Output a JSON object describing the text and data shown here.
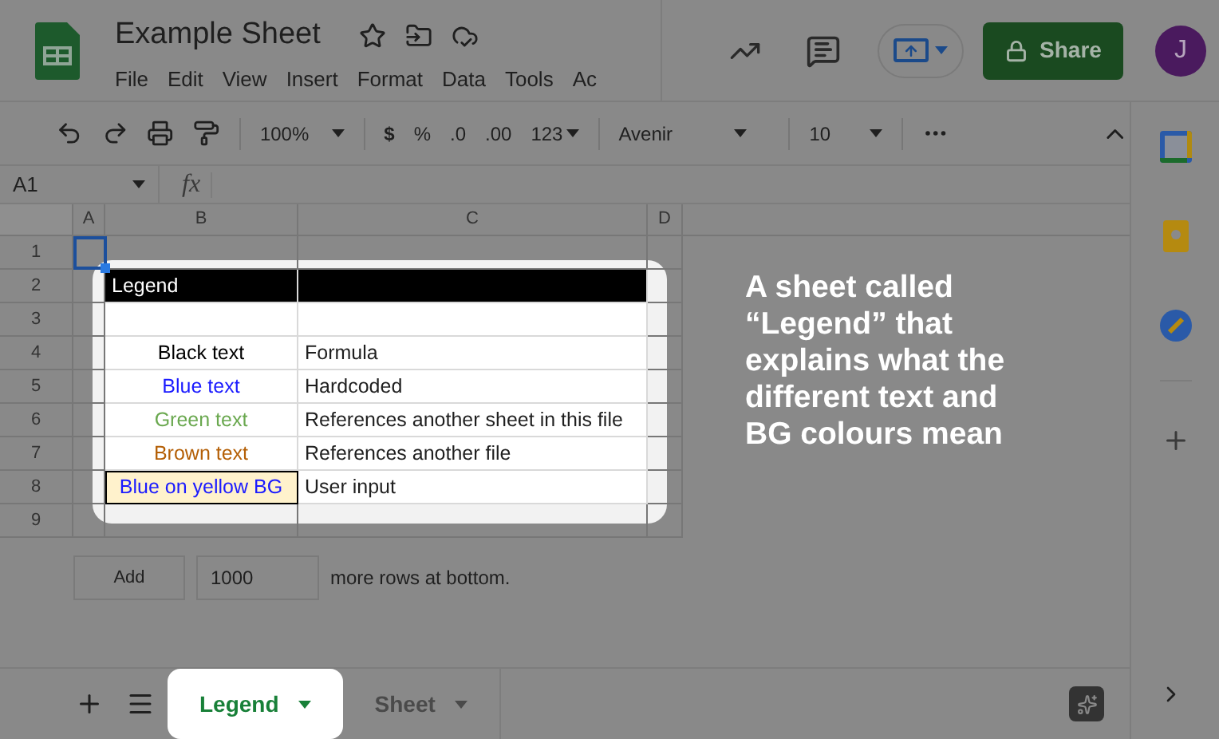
{
  "document": {
    "title": "Example Sheet"
  },
  "menu": [
    "File",
    "Edit",
    "View",
    "Insert",
    "Format",
    "Data",
    "Tools",
    "Ac"
  ],
  "share_button": "Share",
  "account_initial": "J",
  "toolbar": {
    "zoom": "100%",
    "currency": "$",
    "percent": "%",
    "decrease_decimals": ".0",
    "increase_decimals": ".00",
    "number_format": "123",
    "font": "Avenir",
    "font_size": "10"
  },
  "name_box": "A1",
  "formula_label": "fx",
  "columns": [
    "A",
    "B",
    "C",
    "D"
  ],
  "rows": [
    "1",
    "2",
    "3",
    "4",
    "5",
    "6",
    "7",
    "8",
    "9"
  ],
  "legend": {
    "title": "Legend",
    "items": [
      {
        "label": "Black text",
        "description": "Formula",
        "color": "#000000",
        "kind": "plain"
      },
      {
        "label": "Blue text",
        "description": "Hardcoded",
        "color": "#1a1aff",
        "kind": "plain"
      },
      {
        "label": "Green text",
        "description": "References another sheet in this file",
        "color": "#6aa84f",
        "kind": "plain"
      },
      {
        "label": "Brown text",
        "description": "References another file",
        "color": "#b45f06",
        "kind": "plain"
      },
      {
        "label": "Blue on yellow BG",
        "description": "User input",
        "color": "#1a1aff",
        "kind": "filled"
      }
    ]
  },
  "add_rows": {
    "button": "Add",
    "value": "1000",
    "suffix": "more rows at bottom."
  },
  "sheets": [
    {
      "name": "Legend",
      "selected": true
    },
    {
      "name": "Sheet",
      "selected": false
    }
  ],
  "annotation": "A sheet called “Legend” that explains what the different text and BG colours mean"
}
